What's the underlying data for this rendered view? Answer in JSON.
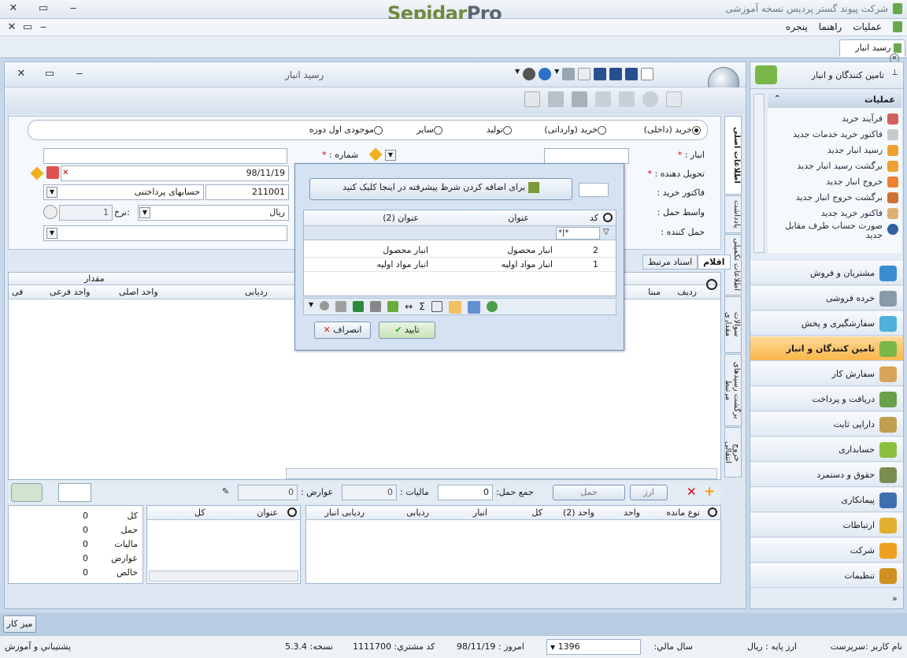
{
  "app": {
    "logo_a": "Sepidar",
    "logo_b": "Pro",
    "window_title": "شرکت پیوند گستر پردیس نسخه آموزشی"
  },
  "menu": {
    "items": [
      "عملیات",
      "راهنما",
      "پنجره"
    ]
  },
  "tab": {
    "label": "رسید انبار"
  },
  "form": {
    "title": "رسید انبار",
    "radios": [
      {
        "label": "خرید (داخلی)",
        "checked": true
      },
      {
        "label": "خرید (وارداتی)",
        "checked": false
      },
      {
        "label": "تولید",
        "checked": false
      },
      {
        "label": "سایر",
        "checked": false
      },
      {
        "label": "موجودی اول دوره",
        "checked": false
      }
    ],
    "labels": {
      "warehouse": "انبار :",
      "number": "شماره :",
      "deliverer": "تحویل دهنده :",
      "invoice": "فاکتور خرید :",
      "transport_agent": "واسط حمل :",
      "carrier": "حمل کننده :",
      "rate": "نرخ:",
      "currency_suffix": "ر:",
      "req": "*"
    },
    "values": {
      "date": "98/11/19",
      "account_code": "211001",
      "account_name": "حسابهای پرداختنی",
      "currency": "ریال",
      "rate": "1"
    }
  },
  "side_tabs": [
    "اطلاعات اصلی",
    "یادداشت",
    "اطلاعات تکمیلی",
    "سوالات مقداری",
    "برگشت رسیدهای مرتبط",
    "خروج انتقالی"
  ],
  "item_tabs": [
    "اقلام",
    "اسناد مرتبط"
  ],
  "items_grid": {
    "group_header": "مقدار",
    "columns": [
      "ردیف",
      "مبنا",
      "ردیابی",
      "واحد اصلی",
      "واحد فرعی",
      "فی"
    ]
  },
  "totals": {
    "freight_button": "حمل",
    "currency_button": "ارز",
    "freight_sum_label": "جمع حمل:",
    "freight_sum": "0",
    "tax_label": "مالیات :",
    "tax": "0",
    "duties_label": "عوارض :",
    "duties": "0"
  },
  "stock_grid": {
    "columns": [
      "نوع مانده",
      "واحد",
      "واحد (2)",
      "کل",
      "انبار",
      "ردیابی",
      "ردیابی انبار"
    ]
  },
  "summary_grid": {
    "columns": [
      "عنوان",
      "کل"
    ],
    "rows": [
      {
        "label": "کل",
        "value": "0"
      },
      {
        "label": "حمل",
        "value": "0"
      },
      {
        "label": "مالیات",
        "value": "0"
      },
      {
        "label": "عوارض",
        "value": "0"
      },
      {
        "label": "خالص",
        "value": "0"
      }
    ]
  },
  "dialog": {
    "filter_hint": "برای اضافه کردن شرط پیشرفته در اینجا کلیک کنید",
    "columns": [
      "کد",
      "عنوان",
      "عنوان (2)"
    ],
    "filter_value": "*|*",
    "rows": [
      {
        "code": "2",
        "title": "انبار محصول",
        "title2": "انبار محصول"
      },
      {
        "code": "1",
        "title": "انبار مواد اولیه",
        "title2": "انبار مواد اولیه"
      }
    ],
    "ok": "تایید",
    "cancel": "انصراف"
  },
  "nav": {
    "header": "تامین کنندگان و انبار",
    "ops_title": "عملیات",
    "ops": [
      "فرآیند خرید",
      "فاکتور خرید خدمات جدید",
      "رسید انبار جدید",
      "برگشت رسید انبار جدید",
      "خروج انبار جدید",
      "برگشت خروج انبار جدید",
      "فاکتور خرید جدید",
      "صورت حساب طرف مقابل جدید"
    ],
    "modules": [
      {
        "label": "مشتریان و فروش",
        "color": "#3a8ed0"
      },
      {
        "label": "خرده فروشی",
        "color": "#8a9aa8"
      },
      {
        "label": "سفارشگیری و پخش",
        "color": "#4fb0d8"
      },
      {
        "label": "تامین کنندگان و انبار",
        "color": "#7ab648",
        "active": true
      },
      {
        "label": "سفارش کار",
        "color": "#d8a45a"
      },
      {
        "label": "دریافت و پرداخت",
        "color": "#6aa04a"
      },
      {
        "label": "دارایی ثابت",
        "color": "#c0a050"
      },
      {
        "label": "حسابداری",
        "color": "#8cc040"
      },
      {
        "label": "حقوق و دستمزد",
        "color": "#7a8c50"
      },
      {
        "label": "پیمانکاری",
        "color": "#3f6fb0"
      },
      {
        "label": "ارتباطات",
        "color": "#e0b030"
      },
      {
        "label": "شرکت",
        "color": "#f0a020"
      },
      {
        "label": "تنظیمات",
        "color": "#d09020"
      }
    ]
  },
  "desk": {
    "label": "میز کار"
  },
  "status": {
    "user_label": "نام کاربر :",
    "user": "سرپرست",
    "base_currency_label": "ارز پایه :",
    "base_currency": "ریال",
    "fiscal_year_label": "سال مالي:",
    "fiscal_year": "1396",
    "today_label": "امروز :",
    "today": "98/11/19",
    "customer_code_label": "کد مشتري:",
    "customer_code": "1111700",
    "version_label": "نسخه:",
    "version": "5.3.4",
    "support": "پشتيباني و آموزش"
  }
}
